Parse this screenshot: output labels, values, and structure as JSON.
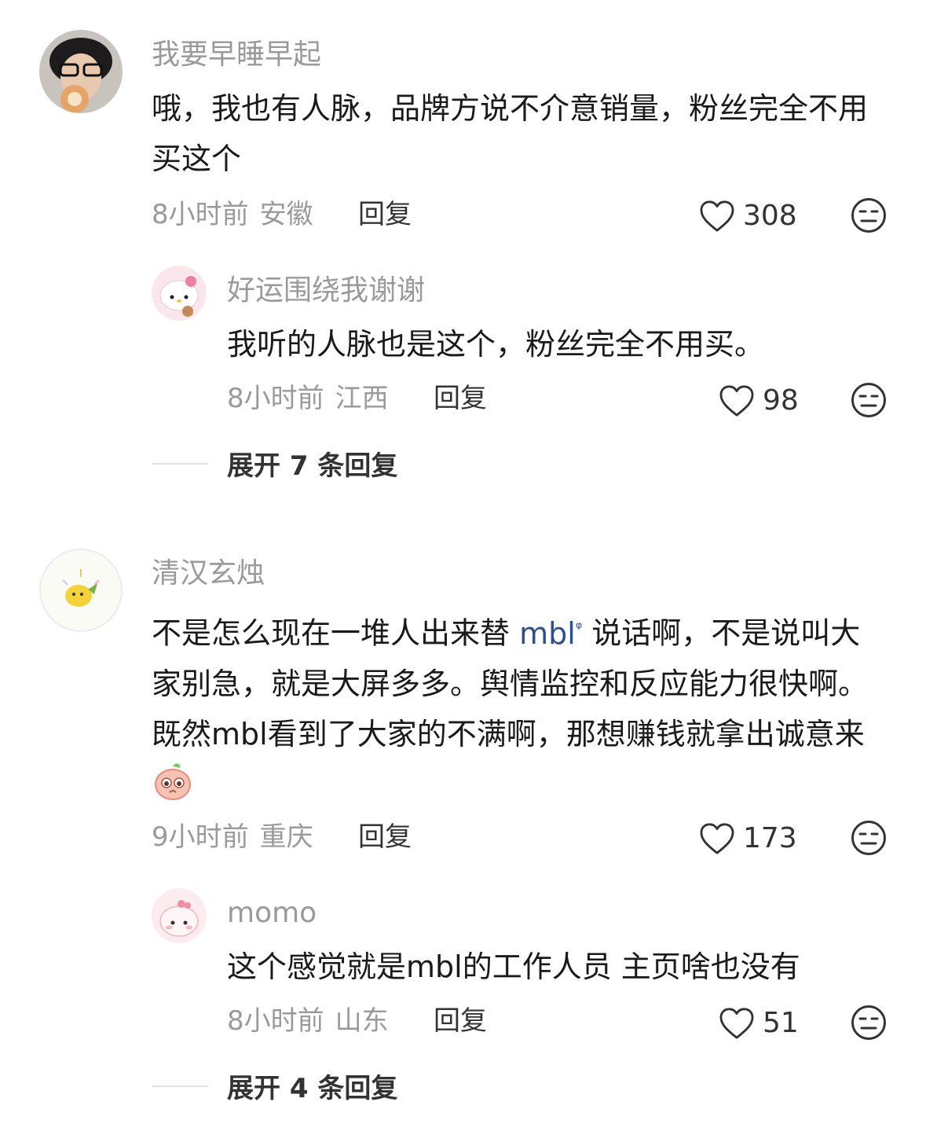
{
  "comments": [
    {
      "user": "我要早睡早起",
      "text": "哦，我也有人脉，品牌方说不介意销量，粉丝完全不用买这个",
      "time": "8小时前",
      "location": "安徽",
      "reply_label": "回复",
      "likes": "308",
      "replies": [
        {
          "user": "好运围绕我谢谢",
          "text": "我听的人脉也是这个，粉丝完全不用买。",
          "time": "8小时前",
          "location": "江西",
          "reply_label": "回复",
          "likes": "98"
        }
      ],
      "expand_label": "展开 7 条回复"
    },
    {
      "user": "清汉玄烛",
      "text_part1": "不是怎么现在一堆人出来替",
      "text_link": "mbl",
      "text_part2": "说话啊，不是说叫大家别急，就是大屏多多。舆情监控和反应能力很快啊。既然mbl看到了大家的不满啊，那想赚钱就拿出诚意来",
      "time": "9小时前",
      "location": "重庆",
      "reply_label": "回复",
      "likes": "173",
      "replies": [
        {
          "user": "momo",
          "text": "这个感觉就是mbl的工作人员 主页啥也没有",
          "time": "8小时前",
          "location": "山东",
          "reply_label": "回复",
          "likes": "51"
        }
      ],
      "expand_label": "展开 4 条回复"
    }
  ],
  "icons": {
    "like": "heart-outline-icon",
    "dislike": "unamused-face-icon",
    "link_search": "search-icon",
    "inline_emoji": "pleading-face-emoji"
  },
  "colors": {
    "username": "#9a9a9a",
    "body_text": "#1a1a1a",
    "link": "#2f4e8a",
    "meta": "#9a9a9a"
  }
}
